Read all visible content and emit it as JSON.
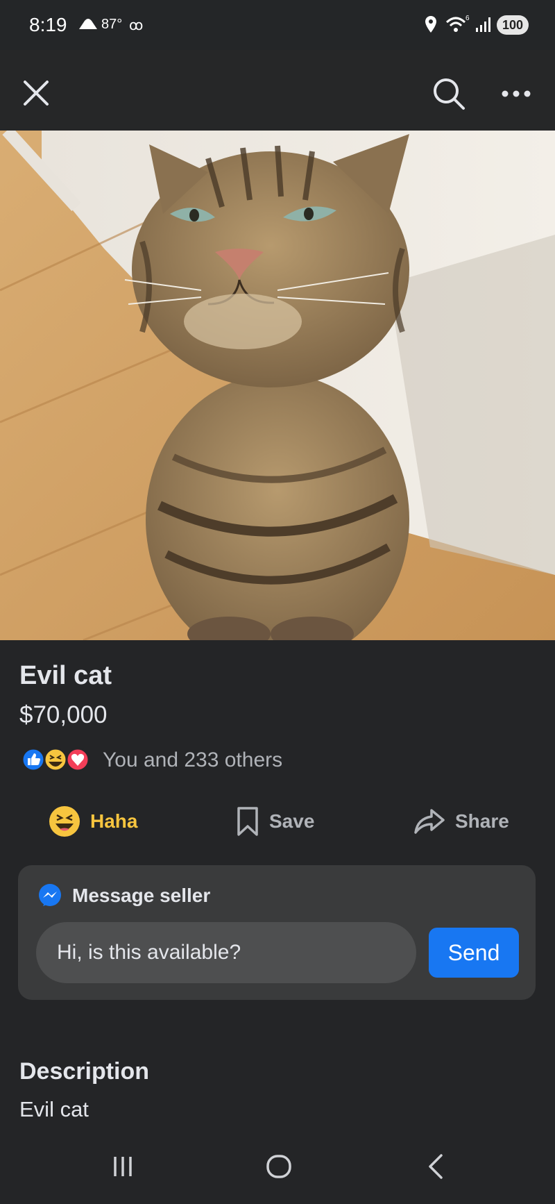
{
  "status_bar": {
    "time": "8:19",
    "temperature": "87°",
    "voicemail": "ꝏ",
    "wifi_badge": "6",
    "battery": "100"
  },
  "top_bar": {
    "icons": [
      "close-icon",
      "search-icon",
      "more-icon"
    ]
  },
  "listing": {
    "title": "Evil cat",
    "price": "$70,000",
    "reactions_text": "You and 233 others",
    "reaction_icons": [
      "like-icon",
      "haha-icon",
      "love-icon"
    ]
  },
  "actions": {
    "haha": "Haha",
    "save": "Save",
    "share": "Share"
  },
  "message_seller": {
    "title": "Message seller",
    "input_value": "Hi, is this available?",
    "send_label": "Send"
  },
  "description": {
    "heading": "Description",
    "body": "Evil cat"
  },
  "colors": {
    "background": "#242527",
    "card": "#3a3b3c",
    "accent": "#1877f2",
    "haha": "#f7c53f"
  }
}
